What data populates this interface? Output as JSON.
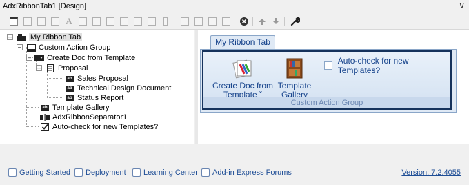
{
  "window": {
    "title": "AdxRibbonTab1 [Design]"
  },
  "toolbar": {
    "icons": [
      "window-icon",
      "form-icon",
      "list-icon",
      "grid-icon",
      "text-icon",
      "checkbox-icon",
      "label-icon",
      "menu-icon",
      "group-icon",
      "image-icon",
      "button-icon",
      "separator-icon",
      "box-icon",
      "dialog-icon",
      "delete-icon",
      "move-up-icon",
      "move-down-icon",
      "wrench-icon"
    ]
  },
  "tree": {
    "nodes": [
      {
        "label": "My Ribbon Tab"
      },
      {
        "label": "Custom Action Group"
      },
      {
        "label": "Create Doc from Template"
      },
      {
        "label": "Proposal"
      },
      {
        "label": "Sales Proposal"
      },
      {
        "label": "Technical Design Document"
      },
      {
        "label": "Status Report"
      },
      {
        "label": "Template Gallery"
      },
      {
        "label": "AdxRibbonSeparator1"
      },
      {
        "label": "Auto-check for new Templates?"
      }
    ]
  },
  "ribbon": {
    "tab_label": "My Ribbon Tab",
    "group_label": "Custom Action Group",
    "create_doc": {
      "line1": "Create Doc from",
      "line2": "Template ˇ"
    },
    "template_gallery": {
      "line1": "Template",
      "line2": "Gallery"
    },
    "autocheck_label": "Auto-check for new Templates?",
    "colors": {
      "tab_text": "#15428b",
      "group_border": "#15325c",
      "body_bg": "#dfe9f5"
    }
  },
  "status": {
    "links": [
      "Getting Started",
      "Deployment",
      "Learning Center",
      "Add-in Express Forums"
    ],
    "version": "Version: 7.2.4055"
  }
}
